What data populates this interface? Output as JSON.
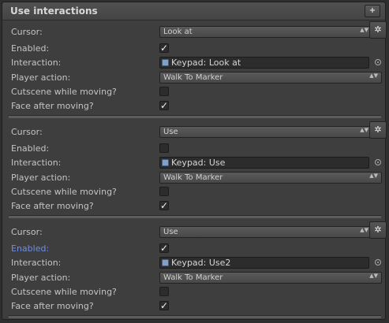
{
  "header": {
    "title": "Use interactions",
    "add_label": "+"
  },
  "labels": {
    "cursor": "Cursor:",
    "enabled": "Enabled:",
    "interaction": "Interaction:",
    "player_action": "Player action:",
    "cutscene": "Cutscene while moving?",
    "face": "Face after moving?"
  },
  "interactions": [
    {
      "cursor": "Look at",
      "enabled": true,
      "interaction": "Keypad: Look at",
      "player_action": "Walk To Marker",
      "cutscene": false,
      "face": true
    },
    {
      "cursor": "Use",
      "enabled": false,
      "interaction": "Keypad: Use",
      "player_action": "Walk To Marker",
      "cutscene": false,
      "face": true
    },
    {
      "cursor": "Use",
      "enabled": true,
      "enabled_highlight": true,
      "interaction": "Keypad: Use2",
      "player_action": "Walk To Marker",
      "cutscene": false,
      "face": true
    }
  ],
  "colors": {
    "highlight_label": "#6f8ee0",
    "panel": "#3e3e3e"
  }
}
